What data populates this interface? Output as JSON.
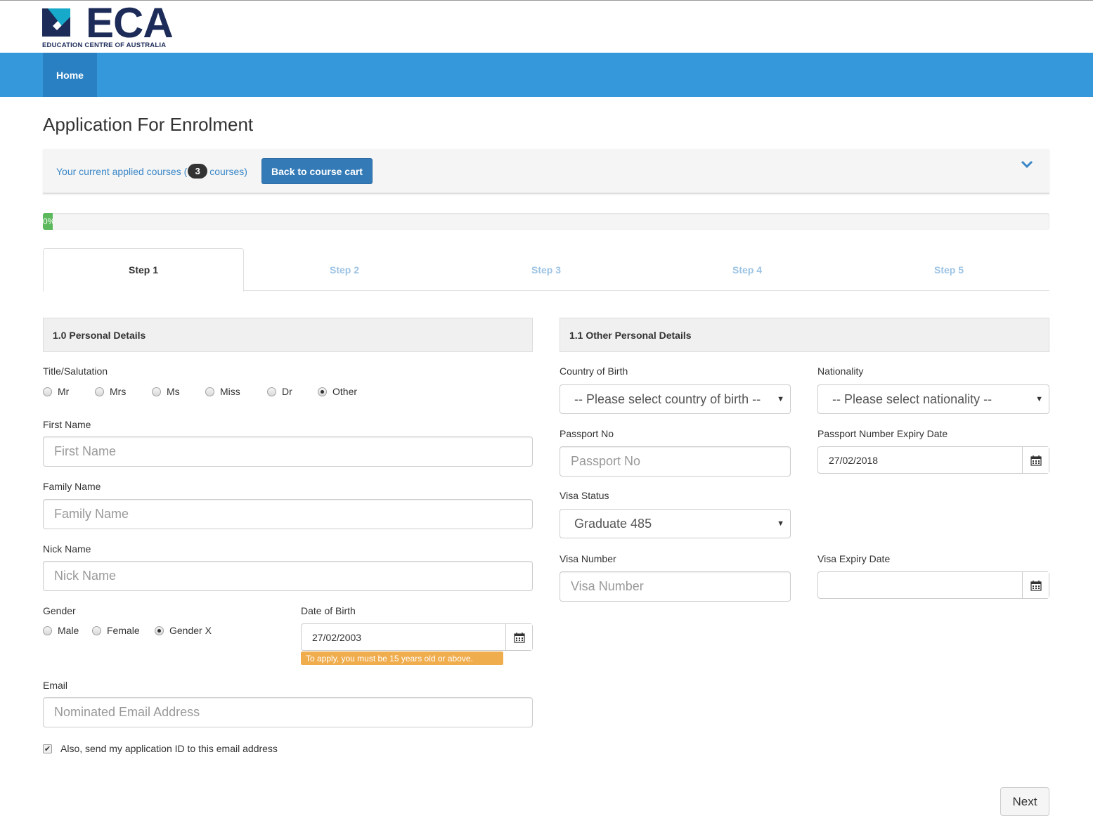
{
  "brand": {
    "logo_text": "ECA",
    "logo_subtitle": "EDUCATION CENTRE OF AUSTRALIA",
    "navy": "#1c2b58",
    "teal": "#17a9c9"
  },
  "navbar": {
    "home_label": "Home",
    "color": "#3498db"
  },
  "page_title": "Application For Enrolment",
  "cart": {
    "text_prefix": "Your current applied courses (",
    "count": "3",
    "text_suffix": " courses)",
    "button_label": "Back to course cart"
  },
  "progress": {
    "label": "0%",
    "percent": 0
  },
  "tabs": [
    {
      "label": "Step 1",
      "active": true
    },
    {
      "label": "Step 2",
      "active": false
    },
    {
      "label": "Step 3",
      "active": false
    },
    {
      "label": "Step 4",
      "active": false
    },
    {
      "label": "Step 5",
      "active": false
    }
  ],
  "personal": {
    "header": "1.0 Personal Details",
    "title_label": "Title/Salutation",
    "title_options": [
      {
        "label": "Mr",
        "checked": false
      },
      {
        "label": "Mrs",
        "checked": false
      },
      {
        "label": "Ms",
        "checked": false
      },
      {
        "label": "Miss",
        "checked": false
      },
      {
        "label": "Dr",
        "checked": false
      },
      {
        "label": "Other",
        "checked": true
      }
    ],
    "first_name_label": "First Name",
    "first_name_placeholder": "First Name",
    "family_name_label": "Family Name",
    "family_name_placeholder": "Family Name",
    "nick_name_label": "Nick Name",
    "nick_name_placeholder": "Nick Name",
    "gender_label": "Gender",
    "gender_options": [
      {
        "label": "Male",
        "checked": false
      },
      {
        "label": "Female",
        "checked": false
      },
      {
        "label": "Gender X",
        "checked": true
      }
    ],
    "dob_label": "Date of Birth",
    "dob_value": "27/02/2003",
    "dob_warning": "To apply, you must be 15 years old or above.",
    "email_label": "Email",
    "email_placeholder": "Nominated Email Address",
    "send_id_label": "Also, send my application ID to this email address",
    "send_id_checked": true
  },
  "other": {
    "header": "1.1 Other Personal Details",
    "country_label": "Country of Birth",
    "country_value": "-- Please select country of birth --",
    "nationality_label": "Nationality",
    "nationality_value": "-- Please select nationality --",
    "passport_label": "Passport No",
    "passport_placeholder": "Passport No",
    "passport_expiry_label": "Passport Number Expiry Date",
    "passport_expiry_value": "27/02/2018",
    "visa_status_label": "Visa Status",
    "visa_status_value": "Graduate 485",
    "visa_number_label": "Visa Number",
    "visa_number_placeholder": "Visa Number",
    "visa_expiry_label": "Visa Expiry Date",
    "visa_expiry_value": ""
  },
  "footer": {
    "next_label": "Next"
  }
}
